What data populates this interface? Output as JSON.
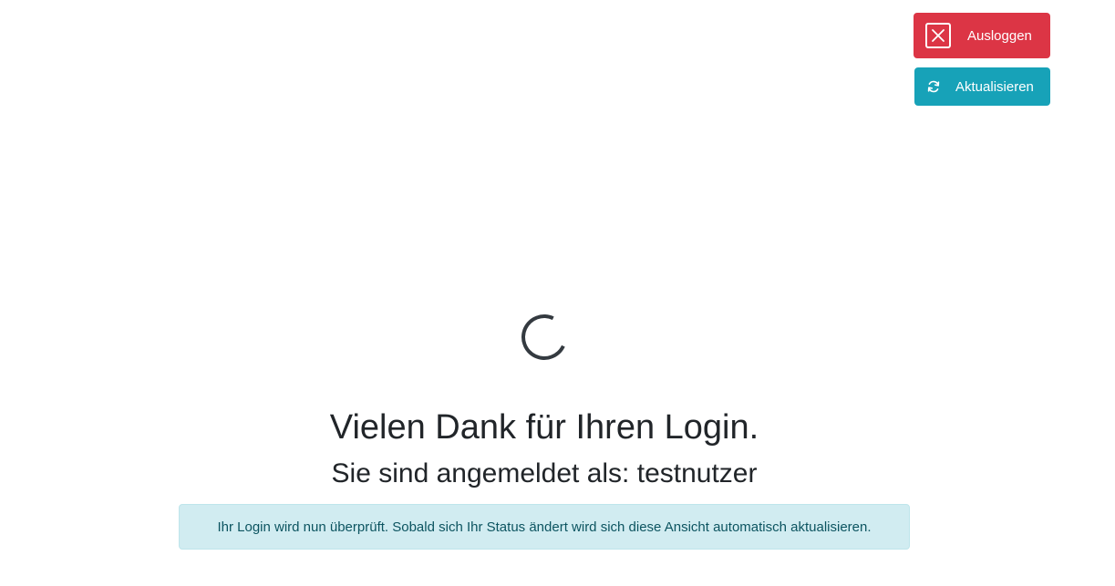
{
  "header": {
    "logout_label": "Ausloggen",
    "refresh_label": "Aktualisieren"
  },
  "icons": {
    "logout": "close-icon",
    "refresh": "refresh-icon",
    "loading": "spinner"
  },
  "main": {
    "title": "Vielen Dank für Ihren Login.",
    "subtitle": "Sie sind angemeldet als: testnutzer",
    "alert_text": "Ihr Login wird nun überprüft. Sobald sich Ihr Status ändert wird sich diese Ansicht automatisch aktualisieren."
  },
  "colors": {
    "danger": "#dc3545",
    "info": "#17a2b8",
    "alert_bg": "#d1ecf1",
    "alert_text": "#0c5460"
  }
}
